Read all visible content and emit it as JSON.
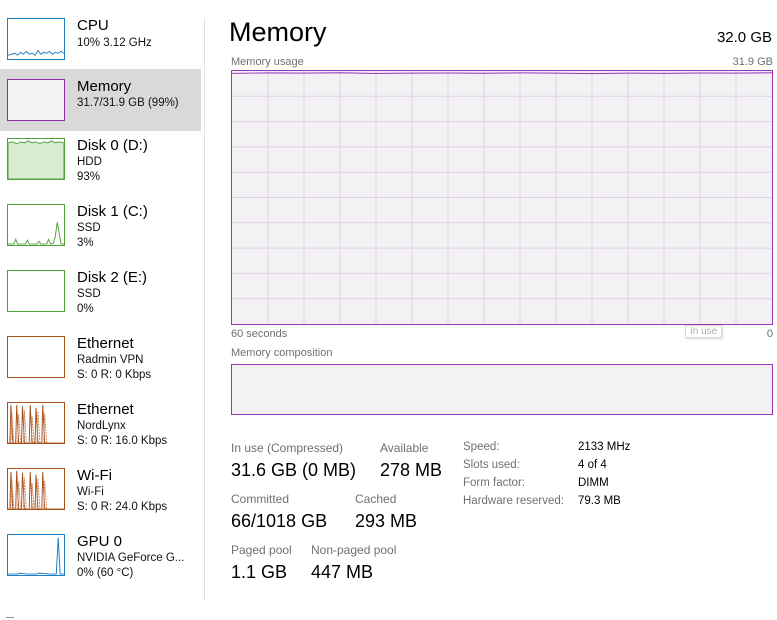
{
  "sidebar": {
    "items": [
      {
        "title": "CPU",
        "sub1": "10%  3.12 GHz",
        "sub2": "",
        "color": "#1a7fc4",
        "selected": false
      },
      {
        "title": "Memory",
        "sub1": "31.7/31.9 GB (99%)",
        "sub2": "",
        "color": "#8b2fb0",
        "selected": true
      },
      {
        "title": "Disk 0 (D:)",
        "sub1": "HDD",
        "sub2": "93%",
        "color": "#4fa33a",
        "selected": false
      },
      {
        "title": "Disk 1 (C:)",
        "sub1": "SSD",
        "sub2": "3%",
        "color": "#4fa33a",
        "selected": false
      },
      {
        "title": "Disk 2 (E:)",
        "sub1": "SSD",
        "sub2": "0%",
        "color": "#4fa33a",
        "selected": false
      },
      {
        "title": "Ethernet",
        "sub1": "Radmin VPN",
        "sub2": "S: 0  R: 0 Kbps",
        "color": "#a7501a",
        "selected": false
      },
      {
        "title": "Ethernet",
        "sub1": "NordLynx",
        "sub2": "S: 0  R: 16.0 Kbps",
        "color": "#a7501a",
        "selected": false
      },
      {
        "title": "Wi-Fi",
        "sub1": "Wi-Fi",
        "sub2": "S: 0  R: 24.0 Kbps",
        "color": "#a7501a",
        "selected": false
      },
      {
        "title": "GPU 0",
        "sub1": "NVIDIA GeForce G...",
        "sub2": "0%  (60 °C)",
        "color": "#1a7fc4",
        "selected": false
      }
    ]
  },
  "main": {
    "title": "Memory",
    "total": "32.0 GB",
    "graph_label": "Memory usage",
    "graph_max": "31.9 GB",
    "time_label": "60 seconds",
    "zero_label": "0",
    "tooltip": "In use",
    "composition_label": "Memory composition",
    "accent_color": "#9a34b8",
    "usage_level": 0.99,
    "stats": {
      "in_use_label": "In use (Compressed)",
      "in_use_value": "31.6 GB (0 MB)",
      "available_label": "Available",
      "available_value": "278 MB",
      "committed_label": "Committed",
      "committed_value": "66/1018 GB",
      "cached_label": "Cached",
      "cached_value": "293 MB",
      "paged_label": "Paged pool",
      "paged_value": "1.1 GB",
      "nonpaged_label": "Non-paged pool",
      "nonpaged_value": "447 MB"
    },
    "details": {
      "speed_label": "Speed:",
      "speed_value": "2133 MHz",
      "slots_label": "Slots used:",
      "slots_value": "4 of 4",
      "form_label": "Form factor:",
      "form_value": "DIMM",
      "reserved_label": "Hardware reserved:",
      "reserved_value": "79.3 MB"
    }
  }
}
